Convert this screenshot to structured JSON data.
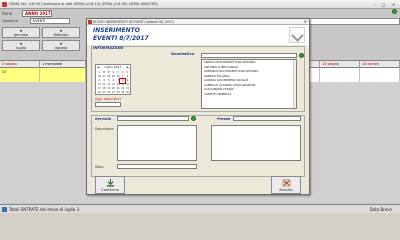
{
  "window": {
    "title": "GEMA Ver. 4.6.90 Contenuto ai dati GEMA (v16.13) GEMA (4.6.90) GEMA (MASTER)",
    "controls": [
      "–",
      "□",
      "✕"
    ]
  },
  "toolbar": {
    "year_label": "Anno",
    "year_value": "ANNO 2017",
    "row2_label": "Gestione",
    "row2_value": "EVENTI"
  },
  "months": [
    {
      "label": "gennaio",
      "icon": "star-icon"
    },
    {
      "label": "febbraio",
      "icon": "star-icon"
    },
    {
      "label": "luglio",
      "icon": "star-icon"
    },
    {
      "label": "agosto",
      "icon": "star-icon"
    }
  ],
  "grid": {
    "days": [
      {
        "label": "2 sabato",
        "red": true
      },
      {
        "label": "1 mercoledì",
        "red": false
      },
      {
        "label": "4 giovedì",
        "red": false
      },
      {
        "label": "5 venerdì",
        "red": false
      },
      {
        "label": "6 sabato",
        "red": false
      },
      {
        "label": "7 domenica",
        "red": false
      },
      {
        "label": "13 sabato",
        "red": true
      },
      {
        "label": "14 domen",
        "red": true
      }
    ],
    "first_cell": "33"
  },
  "status": {
    "text": "Totali ENTRATE del mese di luglio 3",
    "right": "Data Breve"
  },
  "dialog": {
    "title": "NUOVO INSERIMENTO IN EVENTI (sabato 08, 2017)",
    "heading_line1": "INSERIMENTO",
    "heading_line2": "EVENTI 8/7/2017",
    "informazioni_label": "INFORMAZIONI",
    "nominativo_label": "Nominativo",
    "calendar": {
      "month": "luglio 2017",
      "prev": "◄",
      "next": "►",
      "weekdays": [
        "L",
        "M",
        "M",
        "G",
        "V",
        "S",
        "D"
      ],
      "weeks": [
        [
          "26",
          "27",
          "28",
          "29",
          "30",
          "1",
          "2"
        ],
        [
          "3",
          "4",
          "5",
          "6",
          "7",
          "8",
          "9"
        ],
        [
          "10",
          "11",
          "12",
          "13",
          "14",
          "15",
          "16"
        ],
        [
          "17",
          "18",
          "19",
          "20",
          "21",
          "22",
          "23"
        ],
        [
          "24",
          "25",
          "26",
          "27",
          "28",
          "29",
          "30"
        ]
      ],
      "highlight": "8"
    },
    "oggi_label": "Oggi: 08/07/2017",
    "clients": [
      "ANGELO RISTORANTE DON ANTONIO",
      "ANTONIO O MECCANICO",
      "ARMANDO RISTORANTE DON ANTONIO",
      "ARREDO FALANGA",
      "AURORA ASS.IMPRESA SOCIALE",
      "CAPPELLO ALFONSO ASSICURAZIONI",
      "CASALINGHE LETIZIA",
      "CLIENTE GENERICO"
    ],
    "servizio_label": "Servizio",
    "prezzo_label": "Prezzo",
    "descrizione_label": "Descrizione",
    "stato_label": "Stato",
    "confirm_label": "Conferma",
    "cancel_label": "Annulla"
  }
}
